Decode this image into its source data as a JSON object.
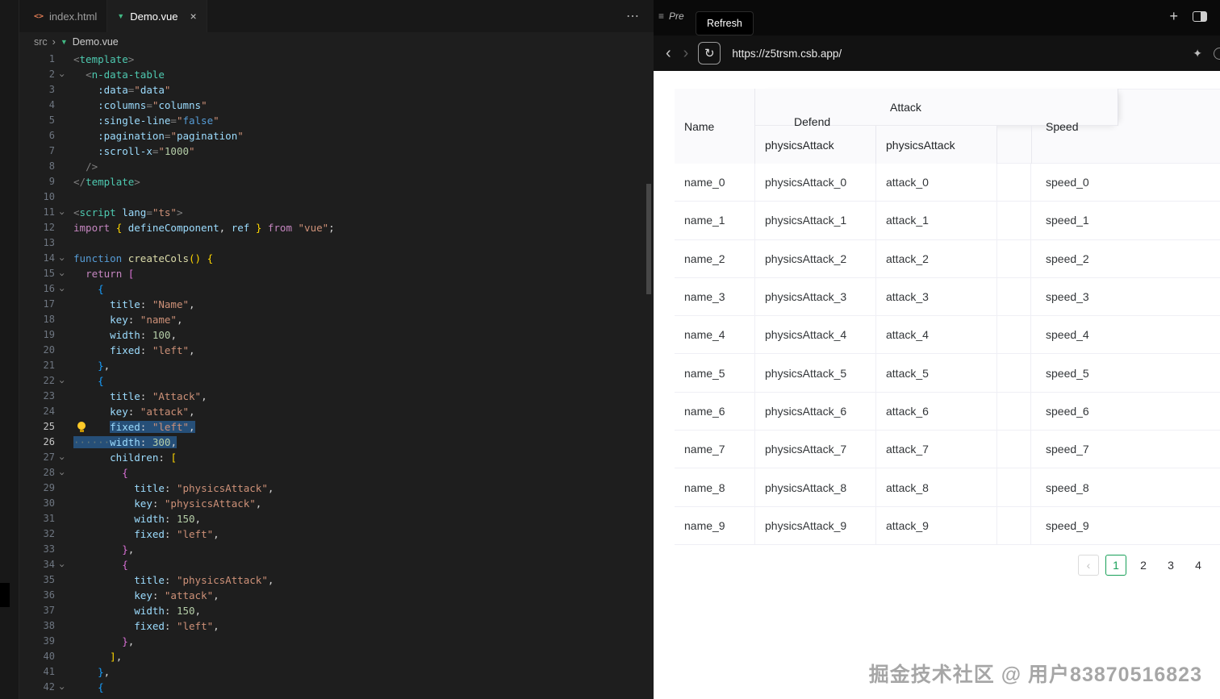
{
  "colors": {
    "accent_green": "#18a058",
    "vue_green": "#41b883",
    "selection": "#264f78"
  },
  "editor": {
    "tabs": [
      {
        "label": "index.html",
        "icon": "html-file-icon",
        "active": false
      },
      {
        "label": "Demo.vue",
        "icon": "vue-file-icon",
        "active": true,
        "close_label": "×"
      }
    ],
    "tab_overflow_label": "⋯",
    "breadcrumb": {
      "folder": "src",
      "separator": "›",
      "file": "Demo.vue"
    },
    "code": {
      "lines": [
        {
          "n": 1,
          "t": [
            [
              "pn",
              "<"
            ],
            [
              "tag",
              "template"
            ],
            [
              "pn",
              ">"
            ]
          ]
        },
        {
          "n": 2,
          "f": 1,
          "t": [
            [
              "pl",
              "  "
            ],
            [
              "pn",
              "<"
            ],
            [
              "tag",
              "n-data-table"
            ]
          ]
        },
        {
          "n": 3,
          "t": [
            [
              "pl",
              "    "
            ],
            [
              "attr",
              ":data"
            ],
            [
              "pn",
              "="
            ],
            [
              "str",
              "\""
            ],
            [
              "var",
              "data"
            ],
            [
              "str",
              "\""
            ]
          ]
        },
        {
          "n": 4,
          "t": [
            [
              "pl",
              "    "
            ],
            [
              "attr",
              ":columns"
            ],
            [
              "pn",
              "="
            ],
            [
              "str",
              "\""
            ],
            [
              "var",
              "columns"
            ],
            [
              "str",
              "\""
            ]
          ]
        },
        {
          "n": 5,
          "t": [
            [
              "pl",
              "    "
            ],
            [
              "attr",
              ":single-line"
            ],
            [
              "pn",
              "="
            ],
            [
              "str",
              "\""
            ],
            [
              "kwb",
              "false"
            ],
            [
              "str",
              "\""
            ]
          ]
        },
        {
          "n": 6,
          "t": [
            [
              "pl",
              "    "
            ],
            [
              "attr",
              ":pagination"
            ],
            [
              "pn",
              "="
            ],
            [
              "str",
              "\""
            ],
            [
              "var",
              "pagination"
            ],
            [
              "str",
              "\""
            ]
          ]
        },
        {
          "n": 7,
          "t": [
            [
              "pl",
              "    "
            ],
            [
              "attr",
              ":scroll-x"
            ],
            [
              "pn",
              "="
            ],
            [
              "str",
              "\""
            ],
            [
              "num",
              "1000"
            ],
            [
              "str",
              "\""
            ]
          ]
        },
        {
          "n": 8,
          "t": [
            [
              "pl",
              "  "
            ],
            [
              "pn",
              "/>"
            ]
          ]
        },
        {
          "n": 9,
          "t": [
            [
              "pn",
              "</"
            ],
            [
              "tag",
              "template"
            ],
            [
              "pn",
              ">"
            ]
          ]
        },
        {
          "n": 10,
          "t": []
        },
        {
          "n": 11,
          "f": 1,
          "t": [
            [
              "pn",
              "<"
            ],
            [
              "tag",
              "script"
            ],
            [
              "pl",
              " "
            ],
            [
              "attr",
              "lang"
            ],
            [
              "pn",
              "="
            ],
            [
              "str",
              "\"ts\""
            ],
            [
              "pn",
              ">"
            ]
          ]
        },
        {
          "n": 12,
          "t": [
            [
              "kw",
              "import"
            ],
            [
              "pl",
              " "
            ],
            [
              "b1",
              "{"
            ],
            [
              "pl",
              " "
            ],
            [
              "var",
              "defineComponent"
            ],
            [
              "pl",
              ", "
            ],
            [
              "var",
              "ref"
            ],
            [
              "pl",
              " "
            ],
            [
              "b1",
              "}"
            ],
            [
              "pl",
              " "
            ],
            [
              "kw",
              "from"
            ],
            [
              "pl",
              " "
            ],
            [
              "str",
              "\"vue\""
            ],
            [
              "pl",
              ";"
            ]
          ]
        },
        {
          "n": 13,
          "t": []
        },
        {
          "n": 14,
          "f": 1,
          "t": [
            [
              "kwb",
              "function"
            ],
            [
              "pl",
              " "
            ],
            [
              "fn",
              "createCols"
            ],
            [
              "b1",
              "()"
            ],
            [
              "pl",
              " "
            ],
            [
              "b1",
              "{"
            ]
          ]
        },
        {
          "n": 15,
          "f": 1,
          "t": [
            [
              "pl",
              "  "
            ],
            [
              "kw",
              "return"
            ],
            [
              "pl",
              " "
            ],
            [
              "b2",
              "["
            ]
          ]
        },
        {
          "n": 16,
          "f": 1,
          "t": [
            [
              "pl",
              "    "
            ],
            [
              "b3",
              "{"
            ]
          ]
        },
        {
          "n": 17,
          "t": [
            [
              "pl",
              "      "
            ],
            [
              "attr",
              "title"
            ],
            [
              "pl",
              ": "
            ],
            [
              "str",
              "\"Name\""
            ],
            [
              "pl",
              ","
            ]
          ]
        },
        {
          "n": 18,
          "t": [
            [
              "pl",
              "      "
            ],
            [
              "attr",
              "key"
            ],
            [
              "pl",
              ": "
            ],
            [
              "str",
              "\"name\""
            ],
            [
              "pl",
              ","
            ]
          ]
        },
        {
          "n": 19,
          "t": [
            [
              "pl",
              "      "
            ],
            [
              "attr",
              "width"
            ],
            [
              "pl",
              ": "
            ],
            [
              "num",
              "100"
            ],
            [
              "pl",
              ","
            ]
          ]
        },
        {
          "n": 20,
          "t": [
            [
              "pl",
              "      "
            ],
            [
              "attr",
              "fixed"
            ],
            [
              "pl",
              ": "
            ],
            [
              "str",
              "\"left\""
            ],
            [
              "pl",
              ","
            ]
          ]
        },
        {
          "n": 21,
          "t": [
            [
              "pl",
              "    "
            ],
            [
              "b3",
              "}"
            ],
            [
              "pl",
              ","
            ]
          ]
        },
        {
          "n": 22,
          "f": 1,
          "t": [
            [
              "pl",
              "    "
            ],
            [
              "b3",
              "{"
            ]
          ]
        },
        {
          "n": 23,
          "t": [
            [
              "pl",
              "      "
            ],
            [
              "attr",
              "title"
            ],
            [
              "pl",
              ": "
            ],
            [
              "str",
              "\"Attack\""
            ],
            [
              "pl",
              ","
            ]
          ]
        },
        {
          "n": 24,
          "t": [
            [
              "pl",
              "      "
            ],
            [
              "attr",
              "key"
            ],
            [
              "pl",
              ": "
            ],
            [
              "str",
              "\"attack\""
            ],
            [
              "pl",
              ","
            ]
          ]
        },
        {
          "n": 25,
          "b": 1,
          "hl": 1,
          "t": [
            [
              "pl",
              "      "
            ],
            [
              "attr",
              "fixed",
              1
            ],
            [
              "pl",
              ": ",
              1
            ],
            [
              "str",
              "\"left\"",
              1
            ],
            [
              "pl",
              ",",
              1
            ]
          ]
        },
        {
          "n": 26,
          "hl": 1,
          "t": [
            [
              "ws",
              "······",
              1
            ],
            [
              "attr",
              "width",
              1
            ],
            [
              "pl",
              ": ",
              1
            ],
            [
              "num",
              "300",
              1
            ],
            [
              "pl",
              ",",
              1
            ]
          ]
        },
        {
          "n": 27,
          "f": 1,
          "t": [
            [
              "pl",
              "      "
            ],
            [
              "attr",
              "children"
            ],
            [
              "pl",
              ": "
            ],
            [
              "b1",
              "["
            ]
          ]
        },
        {
          "n": 28,
          "f": 1,
          "t": [
            [
              "pl",
              "        "
            ],
            [
              "b2",
              "{"
            ]
          ]
        },
        {
          "n": 29,
          "t": [
            [
              "pl",
              "          "
            ],
            [
              "attr",
              "title"
            ],
            [
              "pl",
              ": "
            ],
            [
              "str",
              "\"physicsAttack\""
            ],
            [
              "pl",
              ","
            ]
          ]
        },
        {
          "n": 30,
          "t": [
            [
              "pl",
              "          "
            ],
            [
              "attr",
              "key"
            ],
            [
              "pl",
              ": "
            ],
            [
              "str",
              "\"physicsAttack\""
            ],
            [
              "pl",
              ","
            ]
          ]
        },
        {
          "n": 31,
          "t": [
            [
              "pl",
              "          "
            ],
            [
              "attr",
              "width"
            ],
            [
              "pl",
              ": "
            ],
            [
              "num",
              "150"
            ],
            [
              "pl",
              ","
            ]
          ]
        },
        {
          "n": 32,
          "t": [
            [
              "pl",
              "          "
            ],
            [
              "attr",
              "fixed"
            ],
            [
              "pl",
              ": "
            ],
            [
              "str",
              "\"left\""
            ],
            [
              "pl",
              ","
            ]
          ]
        },
        {
          "n": 33,
          "t": [
            [
              "pl",
              "        "
            ],
            [
              "b2",
              "}"
            ],
            [
              "pl",
              ","
            ]
          ]
        },
        {
          "n": 34,
          "f": 1,
          "t": [
            [
              "pl",
              "        "
            ],
            [
              "b2",
              "{"
            ]
          ]
        },
        {
          "n": 35,
          "t": [
            [
              "pl",
              "          "
            ],
            [
              "attr",
              "title"
            ],
            [
              "pl",
              ": "
            ],
            [
              "str",
              "\"physicsAttack\""
            ],
            [
              "pl",
              ","
            ]
          ]
        },
        {
          "n": 36,
          "t": [
            [
              "pl",
              "          "
            ],
            [
              "attr",
              "key"
            ],
            [
              "pl",
              ": "
            ],
            [
              "str",
              "\"attack\""
            ],
            [
              "pl",
              ","
            ]
          ]
        },
        {
          "n": 37,
          "t": [
            [
              "pl",
              "          "
            ],
            [
              "attr",
              "width"
            ],
            [
              "pl",
              ": "
            ],
            [
              "num",
              "150"
            ],
            [
              "pl",
              ","
            ]
          ]
        },
        {
          "n": 38,
          "t": [
            [
              "pl",
              "          "
            ],
            [
              "attr",
              "fixed"
            ],
            [
              "pl",
              ": "
            ],
            [
              "str",
              "\"left\""
            ],
            [
              "pl",
              ","
            ]
          ]
        },
        {
          "n": 39,
          "t": [
            [
              "pl",
              "        "
            ],
            [
              "b2",
              "}"
            ],
            [
              "pl",
              ","
            ]
          ]
        },
        {
          "n": 40,
          "t": [
            [
              "pl",
              "      "
            ],
            [
              "b1",
              "]"
            ],
            [
              "pl",
              ","
            ]
          ]
        },
        {
          "n": 41,
          "t": [
            [
              "pl",
              "    "
            ],
            [
              "b3",
              "}"
            ],
            [
              "pl",
              ","
            ]
          ]
        },
        {
          "n": 42,
          "f": 1,
          "t": [
            [
              "pl",
              "    "
            ],
            [
              "b3",
              "{"
            ]
          ]
        }
      ]
    }
  },
  "preview": {
    "tab": {
      "label": "Pre",
      "icon": "≡"
    },
    "tooltip": "Refresh",
    "window_buttons": {
      "new_tab": "+"
    },
    "nav": {
      "back": "‹",
      "forward": "›",
      "reload": "↻",
      "url": "https://z5trsm.csb.app/",
      "sparkle": "✦"
    },
    "table": {
      "header": {
        "name": "Name",
        "defend": "Defend",
        "attack_group": "Attack",
        "speed": "Speed",
        "children": [
          "physicsAttack",
          "physicsAttack"
        ]
      },
      "rows": [
        [
          "name_0",
          "physicsAttack_0",
          "attack_0",
          "speed_0"
        ],
        [
          "name_1",
          "physicsAttack_1",
          "attack_1",
          "speed_1"
        ],
        [
          "name_2",
          "physicsAttack_2",
          "attack_2",
          "speed_2"
        ],
        [
          "name_3",
          "physicsAttack_3",
          "attack_3",
          "speed_3"
        ],
        [
          "name_4",
          "physicsAttack_4",
          "attack_4",
          "speed_4"
        ],
        [
          "name_5",
          "physicsAttack_5",
          "attack_5",
          "speed_5"
        ],
        [
          "name_6",
          "physicsAttack_6",
          "attack_6",
          "speed_6"
        ],
        [
          "name_7",
          "physicsAttack_7",
          "attack_7",
          "speed_7"
        ],
        [
          "name_8",
          "physicsAttack_8",
          "attack_8",
          "speed_8"
        ],
        [
          "name_9",
          "physicsAttack_9",
          "attack_9",
          "speed_9"
        ]
      ]
    },
    "pagination": {
      "prev": "‹",
      "pages": [
        "1",
        "2",
        "3",
        "4"
      ],
      "active_page": "1"
    },
    "watermark": "掘金技术社区 @ 用户83870516823"
  }
}
